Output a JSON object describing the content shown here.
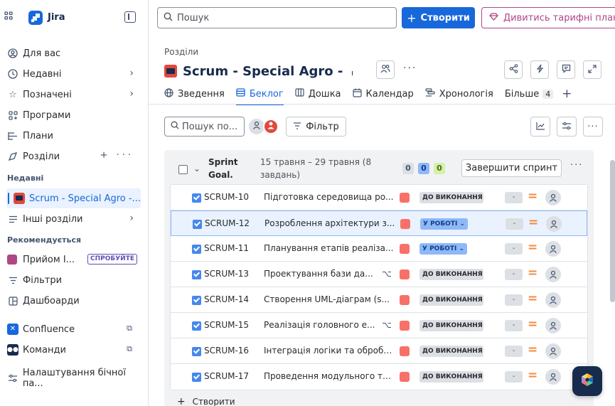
{
  "app": {
    "name": "Jira"
  },
  "sidebar": {
    "items": [
      {
        "label": "Для вас",
        "icon": "user-circle-icon"
      },
      {
        "label": "Недавні",
        "icon": "clock-icon"
      },
      {
        "label": "Позначені",
        "icon": "star-icon"
      },
      {
        "label": "Програми",
        "icon": "apps-icon"
      },
      {
        "label": "Плани",
        "icon": "plans-icon"
      },
      {
        "label": "Розділи",
        "icon": "spaces-icon"
      }
    ],
    "recent_heading": "Недавні",
    "active_project": "Scrum - Special Agro -...",
    "other_spaces": "Інші розділи",
    "recommended_heading": "Рекомендується",
    "recommended_item": "Прийом І...",
    "try_badge": "СПРОБУЙТЕ",
    "filters": "Фільтри",
    "dashboards": "Дашбоарди",
    "confluence": "Confluence",
    "teams": "Команди",
    "settings": "Налаштування бічної па..."
  },
  "topbar": {
    "search_placeholder": "Пошук",
    "create_label": "Створити",
    "plans_label": "Дивитись тарифні плани"
  },
  "header": {
    "breadcrumb": "Розділи",
    "title": "Scrum - Special Agro -",
    "title_mark": "ı"
  },
  "tabs": [
    {
      "label": "Зведення",
      "icon": "globe-icon"
    },
    {
      "label": "Беклог",
      "icon": "list-icon",
      "active": true
    },
    {
      "label": "Дошка",
      "icon": "board-icon"
    },
    {
      "label": "Календар",
      "icon": "calendar-icon"
    },
    {
      "label": "Хронологія",
      "icon": "timeline-icon"
    },
    {
      "label": "Більше",
      "count": "4"
    }
  ],
  "backlog": {
    "search_placeholder": "Пошук по...",
    "filter_label": "Фільтр"
  },
  "sprint": {
    "name": "Sprint Goal.",
    "dates": "15 травня – 29 травня (8 завдань)",
    "count_todo": "0",
    "count_progress": "0",
    "count_done": "0",
    "complete_label": "Завершити спринт",
    "issues": [
      {
        "key": "SCRUM-10",
        "summary": "Підготовка середовища ро...",
        "status": "ДО ВИКОНАННЯ",
        "estimate": "-",
        "has_children": false
      },
      {
        "key": "SCRUM-12",
        "summary": "Розроблення архітектури з...",
        "status": "У РОБОТІ ⌄",
        "estimate": "-",
        "has_children": false
      },
      {
        "key": "SCRUM-11",
        "summary": "Планування етапів реаліза...",
        "status": "У РОБОТІ ⌄",
        "estimate": "-",
        "has_children": false
      },
      {
        "key": "SCRUM-13",
        "summary": "Проектування бази да...",
        "status": "ДО ВИКОНАННЯ",
        "estimate": "-",
        "has_children": true
      },
      {
        "key": "SCRUM-14",
        "summary": "Створення UML-діаграм (s...",
        "status": "ДО ВИКОНАННЯ",
        "estimate": "-",
        "has_children": false
      },
      {
        "key": "SCRUM-15",
        "summary": "Реалізація головного е...",
        "status": "ДО ВИКОНАННЯ",
        "estimate": "-",
        "has_children": true
      },
      {
        "key": "SCRUM-16",
        "summary": "Інтеграція логіки та обробк...",
        "status": "ДО ВИКОНАННЯ",
        "estimate": "-",
        "has_children": false
      },
      {
        "key": "SCRUM-17",
        "summary": "Проведення модульного те...",
        "status": "ДО ВИКОНАННЯ",
        "estimate": "-",
        "has_children": false
      }
    ],
    "create_label": "Створити"
  },
  "colors": {
    "brand": "#1868db",
    "plans": "#ae4787",
    "epic": "#f87168",
    "in_progress": "#8fb8f6",
    "priority_medium": "#f38a3f"
  }
}
